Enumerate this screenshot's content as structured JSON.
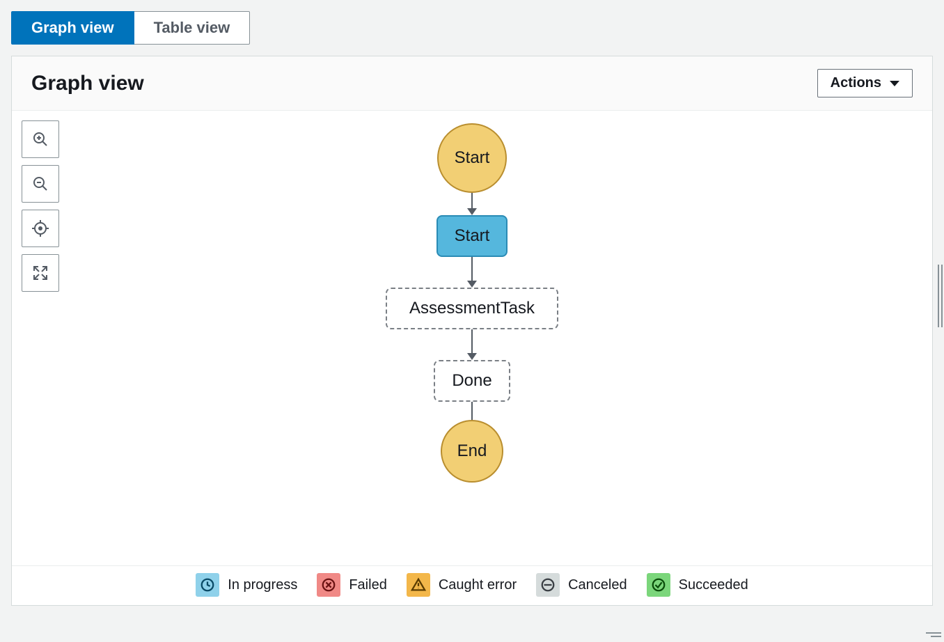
{
  "tabs": {
    "graph_view": "Graph view",
    "table_view": "Table view",
    "active": "graph_view"
  },
  "panel": {
    "title": "Graph view",
    "actions_label": "Actions"
  },
  "toolbar": {
    "zoom_in": "zoom-in",
    "zoom_out": "zoom-out",
    "center": "center",
    "fullscreen": "fullscreen"
  },
  "graph": {
    "nodes": [
      {
        "id": "start_terminal",
        "label": "Start",
        "type": "terminal"
      },
      {
        "id": "start_state",
        "label": "Start",
        "type": "state_in_progress"
      },
      {
        "id": "assessment",
        "label": "AssessmentTask",
        "type": "state_pending"
      },
      {
        "id": "done",
        "label": "Done",
        "type": "state_pending"
      },
      {
        "id": "end_terminal",
        "label": "End",
        "type": "terminal"
      }
    ],
    "edges": [
      [
        "start_terminal",
        "start_state"
      ],
      [
        "start_state",
        "assessment"
      ],
      [
        "assessment",
        "done"
      ],
      [
        "done",
        "end_terminal"
      ]
    ]
  },
  "legend": {
    "items": [
      {
        "key": "in_progress",
        "label": "In progress"
      },
      {
        "key": "failed",
        "label": "Failed"
      },
      {
        "key": "caught_error",
        "label": "Caught error"
      },
      {
        "key": "canceled",
        "label": "Canceled"
      },
      {
        "key": "succeeded",
        "label": "Succeeded"
      }
    ],
    "colors": {
      "in_progress": "#8fd1ea",
      "failed": "#f08986",
      "caught_error": "#f3b74a",
      "canceled": "#d5dbdb",
      "succeeded": "#7bd67b"
    }
  }
}
